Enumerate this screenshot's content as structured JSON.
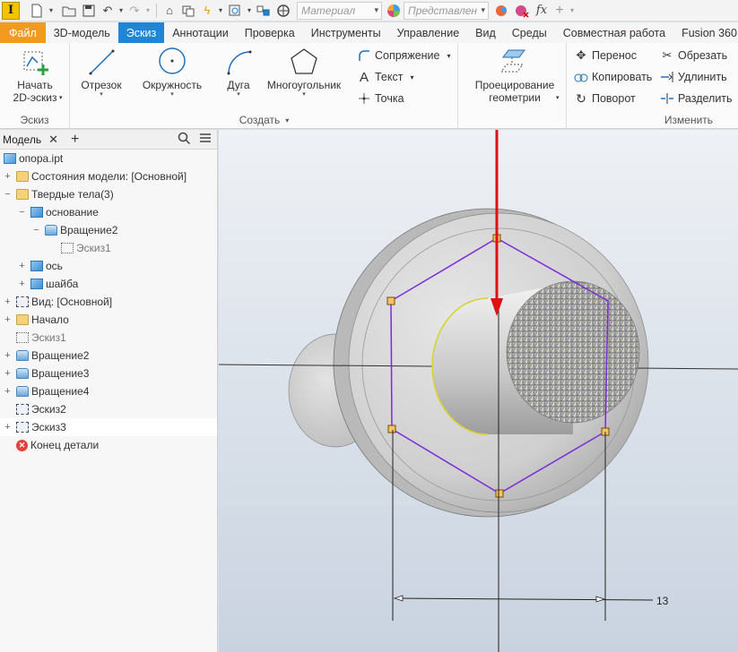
{
  "qat": {
    "app_letter": "I",
    "material_placeholder": "Материал",
    "appearance_placeholder": "Представлен",
    "fx_label": "fx"
  },
  "tabs": [
    "Файл",
    "3D-модель",
    "Эскиз",
    "Аннотации",
    "Проверка",
    "Инструменты",
    "Управление",
    "Вид",
    "Среды",
    "Совместная работа",
    "Fusion 360"
  ],
  "ribbon": {
    "sketch_group": {
      "label": "Эскиз",
      "start_line1": "Начать",
      "start_line2": "2D-эскиз"
    },
    "create_group": {
      "label": "Создать",
      "line": "Отрезок",
      "circle": "Окружность",
      "arc": "Дуга",
      "polygon": "Многоугольник",
      "fillet": "Сопряжение",
      "text": "Текст",
      "point": "Точка"
    },
    "project_group": {
      "line1": "Проецирование",
      "line2": "геометрии"
    },
    "modify_group": {
      "label": "Изменить",
      "move": "Перенос",
      "copy": "Копировать",
      "rotate": "Поворот",
      "trim": "Обрезать",
      "extend": "Удлинить",
      "split": "Разделить"
    }
  },
  "browser": {
    "title": "Модель",
    "items": [
      {
        "label": "опора.ipt"
      },
      {
        "label": "Состояния модели: [Основной]"
      },
      {
        "label": "Твердые тела(3)"
      },
      {
        "label": "основание"
      },
      {
        "label": "Вращение2"
      },
      {
        "label": "Эскиз1"
      },
      {
        "label": "ось"
      },
      {
        "label": "шайба"
      },
      {
        "label": "Вид: [Основной]"
      },
      {
        "label": "Начало"
      },
      {
        "label": "Эскиз1"
      },
      {
        "label": "Вращение2"
      },
      {
        "label": "Вращение3"
      },
      {
        "label": "Вращение4"
      },
      {
        "label": "Эскиз2"
      },
      {
        "label": "Эскиз3"
      },
      {
        "label": "Конец детали"
      }
    ]
  },
  "viewport": {
    "dimension_value": "13",
    "sketch_color": "#7a2cd9",
    "arrow_color": "#e01010"
  }
}
